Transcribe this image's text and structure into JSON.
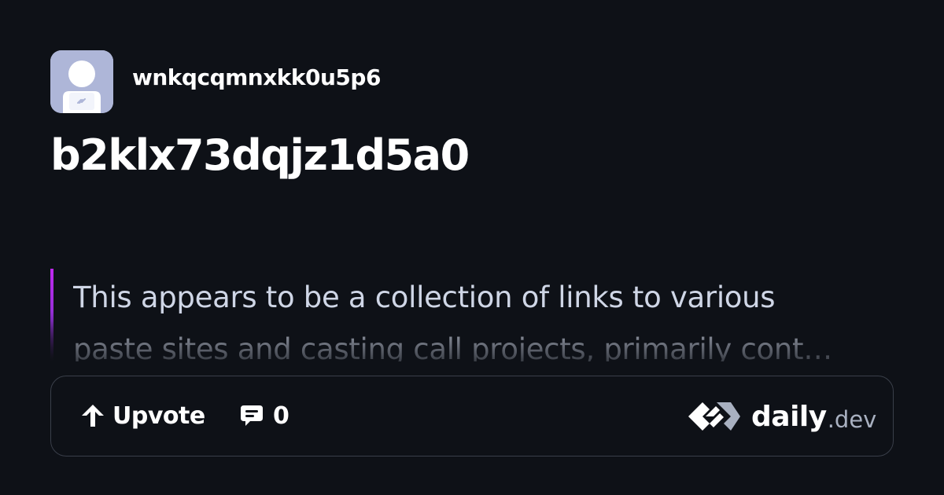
{
  "author": {
    "username": "wnkqcqmnxkk0u5p6",
    "avatar_icon": "default-avatar-icon"
  },
  "post": {
    "title": "b2klx73dqjz1d5a0",
    "summary_line1": "This appears to be a collection of links to various",
    "summary_line2": "paste sites and casting call projects, primarily cont…"
  },
  "actions": {
    "upvote_label": "Upvote",
    "upvote_icon": "arrow-up-icon",
    "comments_count": "0",
    "comments_icon": "comment-icon"
  },
  "brand": {
    "name": "daily",
    "tld": ".dev",
    "logo_icon": "daily-dev-logo-icon"
  },
  "colors": {
    "background": "#0e1117",
    "text_primary": "#ffffff",
    "text_summary": "#cfd6e6",
    "accent_bar": "#c029f0",
    "border": "#3a3f4a",
    "avatar_bg": "#aeb6d8"
  }
}
